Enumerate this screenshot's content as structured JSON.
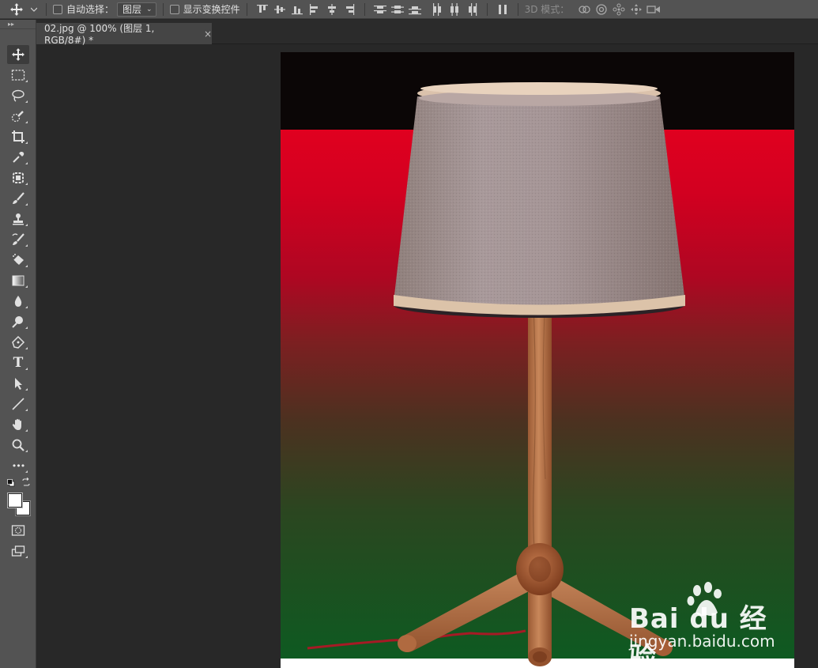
{
  "options_bar": {
    "auto_select_label": "自动选择：",
    "auto_select_target": "图层",
    "show_transform_label": "显示变换控件",
    "mode_3d_label": "3D 模式："
  },
  "document_tab": {
    "title": "02.jpg @ 100% (图层 1, RGB/8#) *",
    "close_glyph": "×"
  },
  "tools": [
    {
      "name": "move-tool",
      "icon": "move-icon",
      "active": true
    },
    {
      "name": "marquee-tool",
      "icon": "rect-marquee-icon"
    },
    {
      "name": "lasso-tool",
      "icon": "lasso-icon"
    },
    {
      "name": "quick-select-tool",
      "icon": "quick-select-icon"
    },
    {
      "name": "crop-tool",
      "icon": "crop-icon"
    },
    {
      "name": "eyedropper-tool",
      "icon": "eyedropper-icon"
    },
    {
      "name": "healing-tool",
      "icon": "healing-icon"
    },
    {
      "name": "brush-tool",
      "icon": "brush-icon"
    },
    {
      "name": "stamp-tool",
      "icon": "stamp-icon"
    },
    {
      "name": "history-brush-tool",
      "icon": "history-brush-icon"
    },
    {
      "name": "eraser-tool",
      "icon": "eraser-icon"
    },
    {
      "name": "gradient-tool",
      "icon": "gradient-icon"
    },
    {
      "name": "blur-tool",
      "icon": "drop-icon"
    },
    {
      "name": "dodge-tool",
      "icon": "dodge-icon"
    },
    {
      "name": "pen-tool",
      "icon": "pen-icon"
    },
    {
      "name": "type-tool",
      "icon": "type-icon"
    },
    {
      "name": "path-select-tool",
      "icon": "arrow-icon"
    },
    {
      "name": "line-tool",
      "icon": "line-icon"
    },
    {
      "name": "hand-tool",
      "icon": "hand-icon"
    },
    {
      "name": "zoom-tool",
      "icon": "zoom-icon"
    },
    {
      "name": "more-tools",
      "icon": "ellipsis-icon"
    }
  ],
  "type_tool_glyph": "T",
  "more_glyph": "•••",
  "colors": {
    "foreground": "#ffffff",
    "background": "#ffffff",
    "gradient_top": "#e0001f",
    "gradient_mid": "#8a1f22",
    "gradient_bottom": "#0f5a21",
    "canvas_top": "#0b0606"
  },
  "watermark": {
    "logo_text": "Bai du 经验",
    "url_text": "jingyan.baidu.com"
  }
}
